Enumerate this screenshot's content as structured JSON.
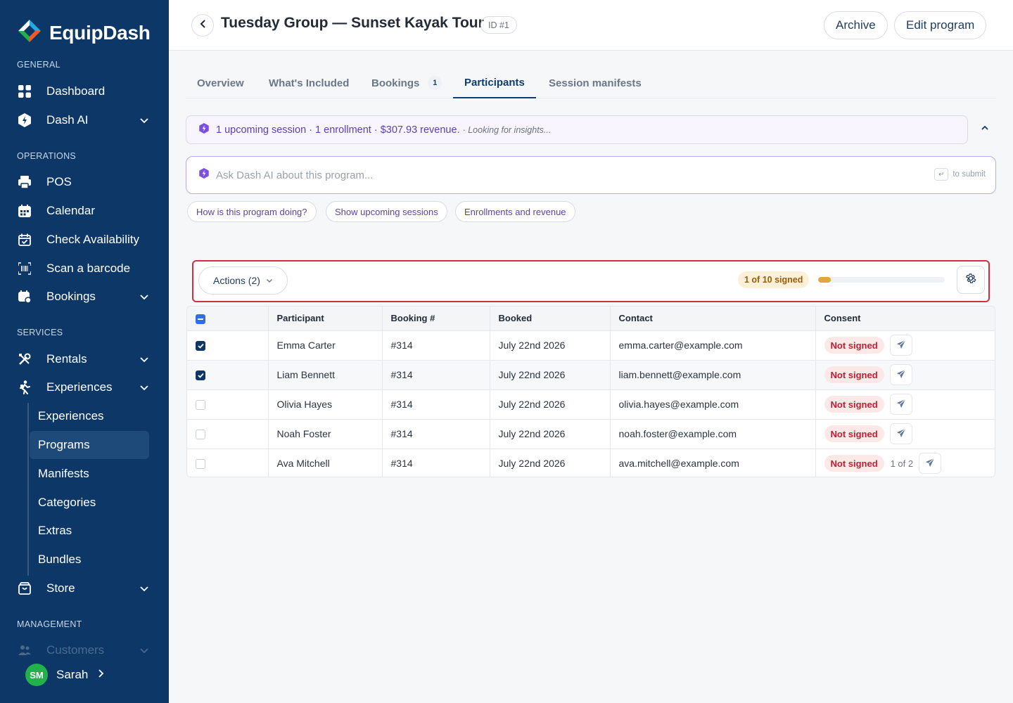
{
  "brand": {
    "name": "EquipDash"
  },
  "sidebar": {
    "sections": {
      "general": "GENERAL",
      "operations": "OPERATIONS",
      "services": "SERVICES",
      "management": "MANAGEMENT"
    },
    "items": {
      "dashboard": "Dashboard",
      "dash_ai": "Dash AI",
      "pos": "POS",
      "calendar": "Calendar",
      "check_availability": "Check Availability",
      "scan_barcode": "Scan a barcode",
      "bookings": "Bookings",
      "rentals": "Rentals",
      "experiences": "Experiences",
      "store": "Store",
      "customers": "Customers"
    },
    "sub_items": [
      "Experiences",
      "Programs",
      "Manifests",
      "Categories",
      "Extras",
      "Bundles"
    ],
    "user": {
      "initials": "SM",
      "name": "Sarah"
    }
  },
  "header": {
    "title": "Tuesday Group — Sunset Kayak Tour",
    "id_badge": "ID #1",
    "archive_label": "Archive",
    "edit_label": "Edit program"
  },
  "tabs": [
    {
      "label": "Overview"
    },
    {
      "label": "What's Included"
    },
    {
      "label": "Bookings",
      "count": "1"
    },
    {
      "label": "Participants"
    },
    {
      "label": "Session manifests"
    }
  ],
  "ai": {
    "summary": "1 upcoming session · 1 enrollment · $307.93 revenue.",
    "insight": "· Looking for insights...",
    "ask_placeholder": "Ask Dash AI about this program...",
    "submit_hint": "to submit",
    "chips": [
      "How is this program doing?",
      "Show upcoming sessions",
      "Enrollments and revenue"
    ]
  },
  "toolbar": {
    "actions_label": "Actions (2)",
    "signed_label": "1 of 10 signed",
    "signed_fraction": 0.1
  },
  "table": {
    "columns": [
      "Participant",
      "Booking #",
      "Booked",
      "Contact",
      "Consent"
    ],
    "rows": [
      {
        "name": "Emma Carter",
        "booking": "#314",
        "booked": "July 22nd 2026",
        "contact": "emma.carter@example.com",
        "consent": "Not signed",
        "extra": ""
      },
      {
        "name": "Liam Bennett",
        "booking": "#314",
        "booked": "July 22nd 2026",
        "contact": "liam.bennett@example.com",
        "consent": "Not signed",
        "extra": ""
      },
      {
        "name": "Olivia Hayes",
        "booking": "#314",
        "booked": "July 22nd 2026",
        "contact": "olivia.hayes@example.com",
        "consent": "Not signed",
        "extra": ""
      },
      {
        "name": "Noah Foster",
        "booking": "#314",
        "booked": "July 22nd 2026",
        "contact": "noah.foster@example.com",
        "consent": "Not signed",
        "extra": ""
      },
      {
        "name": "Ava Mitchell",
        "booking": "#314",
        "booked": "July 22nd 2026",
        "contact": "ava.mitchell@example.com",
        "consent": "Not signed",
        "extra": "1 of 2"
      }
    ]
  },
  "colors": {
    "sidebar_bg": "#0c3767",
    "accent_purple": "#5b3fb4",
    "danger": "#c01f33",
    "warning": "#e6a440"
  }
}
